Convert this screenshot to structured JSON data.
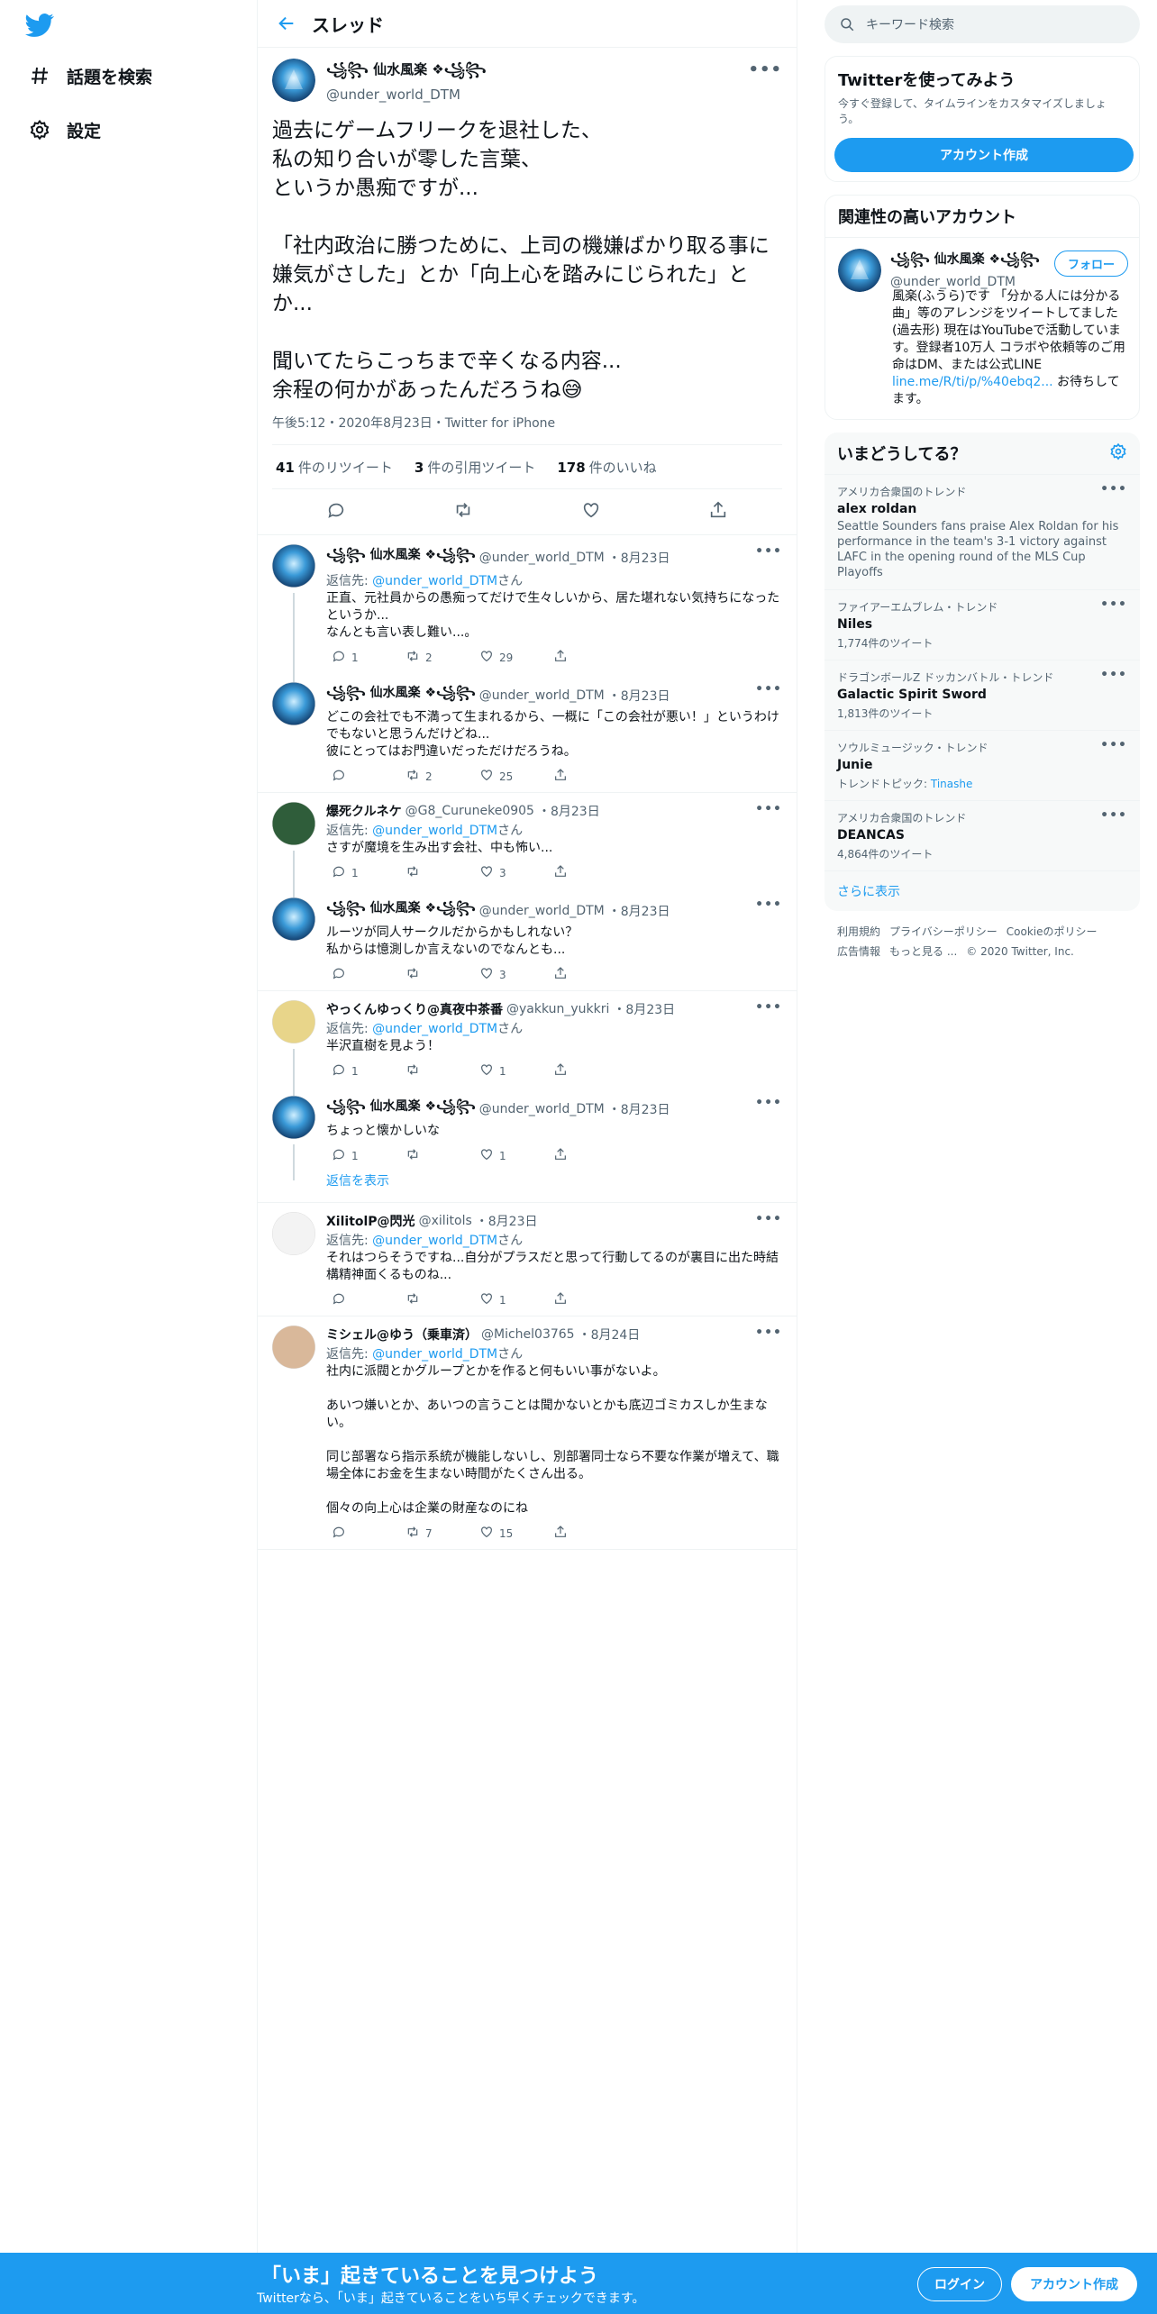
{
  "nav": {
    "explore": "話題を検索",
    "settings": "設定"
  },
  "header": {
    "title": "スレッド"
  },
  "focused": {
    "name": "꧁꧂ 仙水風楽 ❖꧁꧂",
    "handle": "@under_world_DTM",
    "text": "過去にゲームフリークを退社した、\n私の知り合いが零した言葉、\nというか愚痴ですが...\n\n「社内政治に勝つために、上司の機嫌ばかり取る事に嫌気がさした」とか「向上心を踏みにじられた」とか...\n\n聞いてたらこっちまで辛くなる内容...\n余程の何かがあったんだろうね😅",
    "meta": "午後5:12・2020年8月23日・Twitter for iPhone",
    "retweets_count": "41",
    "retweets_label": "件のリツイート",
    "quotes_count": "3",
    "quotes_label": "件の引用ツイート",
    "likes_count": "178",
    "likes_label": "件のいいね"
  },
  "replies": [
    {
      "name": "꧁꧂ 仙水風楽 ❖꧁꧂",
      "handle": "@under_world_DTM",
      "date": "・8月23日",
      "reply_to_prefix": "返信先: ",
      "reply_to": "@under_world_DTM",
      "reply_to_suffix": "さん",
      "text": "正直、元社員からの愚痴ってだけで生々しいから、居た堪れない気持ちになったというか...\nなんとも言い表し難い...。",
      "reply_count": "1",
      "rt_count": "2",
      "like_count": "29"
    },
    {
      "name": "꧁꧂ 仙水風楽 ❖꧁꧂",
      "handle": "@under_world_DTM",
      "date": "・8月23日",
      "text": "どこの会社でも不満って生まれるから、一概に「この会社が悪い！」というわけでもないと思うんだけどね...\n彼にとってはお門違いだっただけだろうね。",
      "reply_count": "",
      "rt_count": "2",
      "like_count": "25"
    },
    {
      "name": "爆死クルネケ",
      "handle": "@G8_Curuneke0905",
      "date": "・8月23日",
      "reply_to_prefix": "返信先: ",
      "reply_to": "@under_world_DTM",
      "reply_to_suffix": "さん",
      "text": "さすが魔境を生み出す会社、中も怖い...",
      "reply_count": "1",
      "rt_count": "",
      "like_count": "3"
    },
    {
      "name": "꧁꧂ 仙水風楽 ❖꧁꧂",
      "handle": "@under_world_DTM",
      "date": "・8月23日",
      "text": "ルーツが同人サークルだからかもしれない？\n私からは憶測しか言えないのでなんとも...",
      "reply_count": "",
      "rt_count": "",
      "like_count": "3"
    },
    {
      "name": "やっくんゆっくり@真夜中茶番",
      "handle": "@yakkun_yukkri",
      "date": "・8月23日",
      "reply_to_prefix": "返信先: ",
      "reply_to": "@under_world_DTM",
      "reply_to_suffix": "さん",
      "text": "半沢直樹を見よう！",
      "reply_count": "1",
      "rt_count": "",
      "like_count": "1"
    },
    {
      "name": "꧁꧂ 仙水風楽 ❖꧁꧂",
      "handle": "@under_world_DTM",
      "date": "・8月23日",
      "text": "ちょっと懐かしいな",
      "reply_count": "1",
      "rt_count": "",
      "like_count": "1"
    },
    {
      "name": "XilitolP@閃光",
      "handle": "@xilitols",
      "date": "・8月23日",
      "reply_to_prefix": "返信先: ",
      "reply_to": "@under_world_DTM",
      "reply_to_suffix": "さん",
      "text": "それはつらそうですね...自分がプラスだと思って行動してるのが裏目に出た時結構精神面くるものね...",
      "reply_count": "",
      "rt_count": "",
      "like_count": "1"
    },
    {
      "name": "ミシェル@ゆう（乗車済）",
      "handle": "@Michel03765",
      "date": "・8月24日",
      "reply_to_prefix": "返信先: ",
      "reply_to": "@under_world_DTM",
      "reply_to_suffix": "さん",
      "text": "社内に派閥とかグループとかを作ると何もいい事がないよ。\n\nあいつ嫌いとか、あいつの言うことは聞かないとかも底辺ゴミカスしか生まない。\n\n同じ部署なら指示系統が機能しないし、別部署同士なら不要な作業が増えて、職場全体にお金を生まない時間がたくさん出る。\n\n個々の向上心は企業の財産なのにね",
      "reply_count": "",
      "rt_count": "7",
      "like_count": "15"
    }
  ],
  "show_replies": "返信を表示",
  "search": {
    "placeholder": "キーワード検索"
  },
  "signup_card": {
    "title": "Twitterを使ってみよう",
    "desc": "今すぐ登録して、タイムラインをカスタマイズしましょう。",
    "button": "アカウント作成"
  },
  "related": {
    "title": "関連性の高いアカウント",
    "name": "꧁꧂ 仙水風楽 ❖꧁꧂",
    "handle": "@under_world_DTM",
    "follow": "フォロー",
    "bio": "風楽(ふうら)です 「分かる人には分かる曲」等のアレンジをツイートしてました(過去形) 現在はYouTubeで活動しています。登録者10万人 コラボや依頼等のご用命はDM、または公式LINE ",
    "bio_link": "line.me/R/ti/p/%40ebq2...",
    "bio_end": " お待ちしてます。"
  },
  "trends": {
    "title": "いまどうしてる？",
    "items": [
      {
        "context": "アメリカ合衆国のトレンド",
        "name": "alex roldan",
        "desc": "Seattle Sounders fans praise Alex Roldan for his performance in the team's 3-1 victory against LAFC in the opening round of the MLS Cup Playoffs",
        "count": ""
      },
      {
        "context": "ファイアーエムブレム・トレンド",
        "name": "Niles",
        "desc": "",
        "count": "1,774件のツイート"
      },
      {
        "context": "ドラゴンボールZ ドッカンバトル・トレンド",
        "name": "Galactic Spirit Sword",
        "desc": "",
        "count": "1,813件のツイート"
      },
      {
        "context": "ソウルミュージック・トレンド",
        "name": "Junie",
        "desc": "",
        "count": "トレンドトピック: ",
        "count_link": "Tinashe"
      },
      {
        "context": "アメリカ合衆国のトレンド",
        "name": "DEANCAS",
        "desc": "",
        "count": "4,864件のツイート"
      }
    ],
    "show_more": "さらに表示"
  },
  "footer": {
    "terms": "利用規約",
    "privacy": "プライバシーポリシー",
    "cookie": "Cookieのポリシー",
    "ads": "広告情報",
    "more": "もっと見る ...",
    "copyright": "© 2020 Twitter, Inc."
  },
  "bottom_bar": {
    "title": "「いま」起きていることを見つけよう",
    "subtitle": "Twitterなら、「いま」起きていることをいち早くチェックできます。",
    "login": "ログイン",
    "signup": "アカウント作成"
  },
  "colors": {
    "accent": "#1d9bf0",
    "text": "#0f1419",
    "muted": "#536471"
  }
}
